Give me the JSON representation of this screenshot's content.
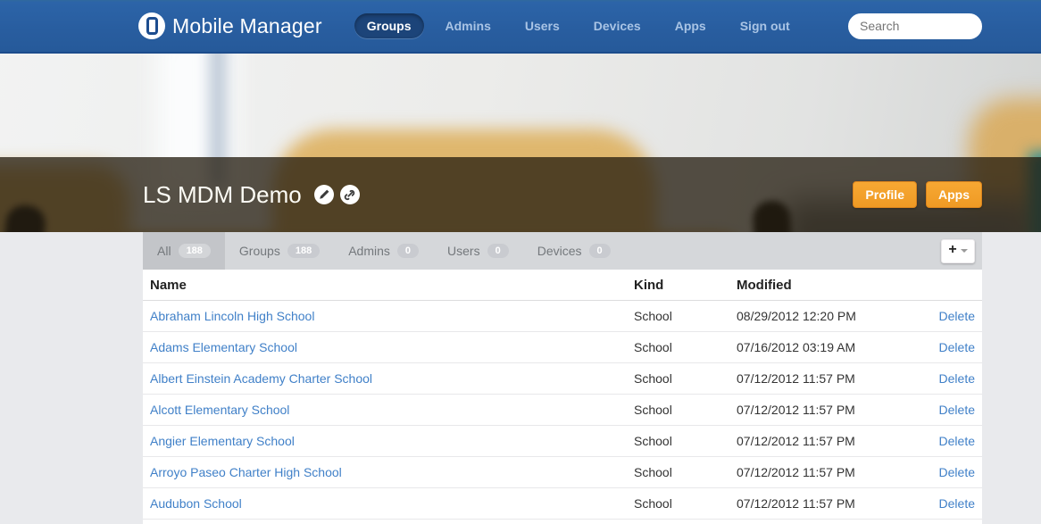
{
  "navbar": {
    "brand": "Mobile Manager",
    "items": [
      {
        "label": "Groups",
        "active": true
      },
      {
        "label": "Admins",
        "active": false
      },
      {
        "label": "Users",
        "active": false
      },
      {
        "label": "Devices",
        "active": false
      },
      {
        "label": "Apps",
        "active": false
      },
      {
        "label": "Sign out",
        "active": false
      }
    ],
    "search_placeholder": "Search"
  },
  "hero": {
    "title": "LS MDM Demo",
    "icon_buttons": [
      "edit-pencil",
      "link"
    ],
    "buttons": [
      {
        "label": "Profile"
      },
      {
        "label": "Apps"
      }
    ],
    "accent_color": "#f0a028"
  },
  "tabs": [
    {
      "label": "All",
      "count": "188",
      "active": true
    },
    {
      "label": "Groups",
      "count": "188",
      "active": false
    },
    {
      "label": "Admins",
      "count": "0",
      "active": false
    },
    {
      "label": "Users",
      "count": "0",
      "active": false
    },
    {
      "label": "Devices",
      "count": "0",
      "active": false
    }
  ],
  "add_button": {
    "glyph": "+"
  },
  "table": {
    "columns": [
      "Name",
      "Kind",
      "Modified"
    ],
    "action_label": "Delete",
    "rows": [
      {
        "name": "Abraham Lincoln High School",
        "kind": "School",
        "modified": "08/29/2012 12:20 PM"
      },
      {
        "name": "Adams Elementary School",
        "kind": "School",
        "modified": "07/16/2012 03:19 AM"
      },
      {
        "name": "Albert Einstein Academy Charter School",
        "kind": "School",
        "modified": "07/12/2012 11:57 PM"
      },
      {
        "name": "Alcott Elementary School",
        "kind": "School",
        "modified": "07/12/2012 11:57 PM"
      },
      {
        "name": "Angier Elementary School",
        "kind": "School",
        "modified": "07/12/2012 11:57 PM"
      },
      {
        "name": "Arroyo Paseo Charter High School",
        "kind": "School",
        "modified": "07/12/2012 11:57 PM"
      },
      {
        "name": "Audubon School",
        "kind": "School",
        "modified": "07/12/2012 11:57 PM"
      }
    ]
  },
  "colors": {
    "navbar_blue": "#285d9f",
    "active_pill": "#1c4479",
    "link_blue": "#4080c8",
    "tabbar_gray": "#d5d7da",
    "orange": "#f0a028"
  }
}
